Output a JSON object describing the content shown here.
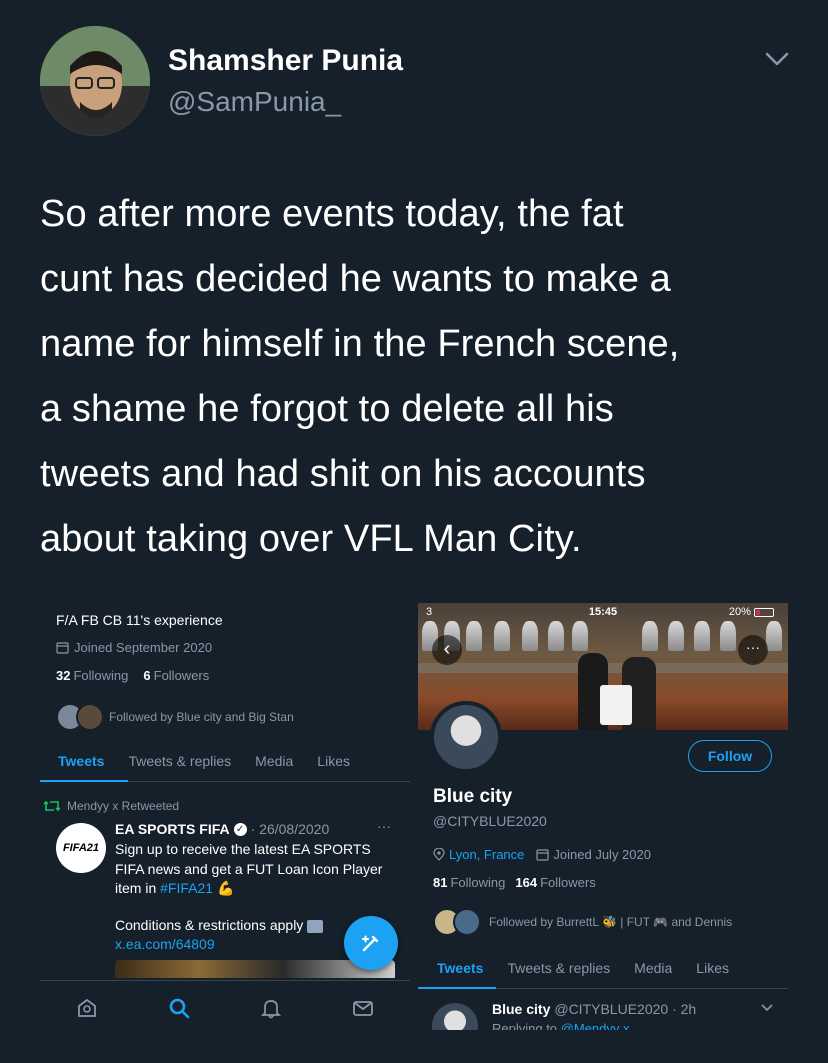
{
  "author": {
    "name": "Shamsher Punia",
    "handle": "@SamPunia_"
  },
  "tweet": {
    "lines": [
      "So after more events today, the fat",
      "cunt has decided he wants to make a",
      "name for himself in the French scene,",
      "a shame he forgot to delete all his",
      "tweets and had shit on his accounts",
      "about taking over VFL Man City."
    ]
  },
  "left_screenshot": {
    "profile_name": "F/A FB CB 11's experience",
    "joined": "Joined September 2020",
    "following_count": "32",
    "following_label": "Following",
    "followers_count": "6",
    "followers_label": "Followers",
    "followed_by": "Followed by Blue city and Big Stan",
    "tabs": [
      "Tweets",
      "Tweets & replies",
      "Media",
      "Likes"
    ],
    "retweet_label": "Mendyy x Retweeted",
    "ea_logo_text": "FIFA21",
    "ea_name": "EA SPORTS FIFA",
    "ea_date": "· 26/08/2020",
    "ea_more": "···",
    "ea_body_1": "Sign up to receive the latest EA SPORTS FIFA news and get a FUT Loan Icon Player item in",
    "ea_hashtag": "#FIFA21",
    "ea_cond": "Conditions & restrictions apply",
    "ea_link": "x.ea.com/64809"
  },
  "right_screenshot": {
    "status": {
      "signal": "3",
      "time": "15:45",
      "battery": "20%"
    },
    "name": "Blue city",
    "handle": "@CITYBLUE2020",
    "follow_button": "Follow",
    "location": "Lyon, France",
    "joined": "Joined July 2020",
    "following_count": "81",
    "following_label": "Following",
    "followers_count": "164",
    "followers_label": "Followers",
    "followed_by": "Followed by BurrettL",
    "followed_by_rest": "| FUT",
    "followed_by_end": "and Dennis",
    "tabs": [
      "Tweets",
      "Tweets & replies",
      "Media",
      "Likes"
    ],
    "tweet_name": "Blue city",
    "tweet_handle": "@CITYBLUE2020 · 2h",
    "reply_prefix": "Replying to",
    "reply_to": "@Mendyy x"
  },
  "colors": {
    "background": "#15202b",
    "accent": "#1da1f2",
    "secondary_text": "#8899a6",
    "divider": "#38444d"
  }
}
